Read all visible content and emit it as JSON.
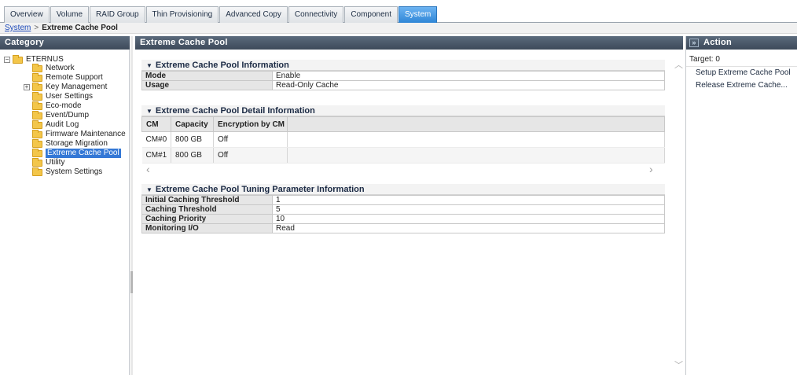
{
  "tabs": [
    {
      "label": "Overview"
    },
    {
      "label": "Volume"
    },
    {
      "label": "RAID Group"
    },
    {
      "label": "Thin Provisioning"
    },
    {
      "label": "Advanced Copy"
    },
    {
      "label": "Connectivity"
    },
    {
      "label": "Component"
    },
    {
      "label": "System",
      "active": true
    }
  ],
  "breadcrumb": {
    "parent": "System",
    "separator": ">",
    "current": "Extreme Cache Pool"
  },
  "category": {
    "title": "Category",
    "root": "ETERNUS",
    "items": [
      {
        "label": "Network"
      },
      {
        "label": "Remote Support"
      },
      {
        "label": "Key Management",
        "expandable": true
      },
      {
        "label": "User Settings"
      },
      {
        "label": "Eco-mode"
      },
      {
        "label": "Event/Dump"
      },
      {
        "label": "Audit Log"
      },
      {
        "label": "Firmware Maintenance"
      },
      {
        "label": "Storage Migration"
      },
      {
        "label": "Extreme Cache Pool",
        "selected": true
      },
      {
        "label": "Utility"
      },
      {
        "label": "System Settings"
      }
    ]
  },
  "main": {
    "title": "Extreme Cache Pool",
    "info": {
      "title": "Extreme Cache Pool Information",
      "rows": [
        {
          "key": "Mode",
          "value": "Enable"
        },
        {
          "key": "Usage",
          "value": "Read-Only Cache"
        }
      ]
    },
    "detail": {
      "title": "Extreme Cache Pool Detail Information",
      "columns": [
        "CM",
        "Capacity",
        "Encryption by CM"
      ],
      "rows": [
        {
          "cm": "CM#0",
          "capacity": "800 GB",
          "encryption": "Off"
        },
        {
          "cm": "CM#1",
          "capacity": "800 GB",
          "encryption": "Off"
        }
      ]
    },
    "tuning": {
      "title": "Extreme Cache Pool Tuning Parameter Information",
      "rows": [
        {
          "key": "Initial Caching Threshold",
          "value": "1"
        },
        {
          "key": "Caching Threshold",
          "value": "5"
        },
        {
          "key": "Caching Priority",
          "value": "10"
        },
        {
          "key": "Monitoring I/O",
          "value": "Read"
        }
      ]
    }
  },
  "action": {
    "title": "Action",
    "target": "Target: 0",
    "items": [
      {
        "label": "Setup Extreme Cache Pool"
      },
      {
        "label": "Release Extreme Cache..."
      }
    ]
  },
  "icons": {
    "folder": "folder-icon",
    "collapse": "collapse-toggle-icon",
    "expand": "expand-toggle-icon",
    "section": "section-collapse-icon",
    "panel_toggle": "double-chevron-icon"
  },
  "colors": {
    "accent": "#3478d6",
    "active_tab": "#2f86d6",
    "header": "#4a5868"
  }
}
